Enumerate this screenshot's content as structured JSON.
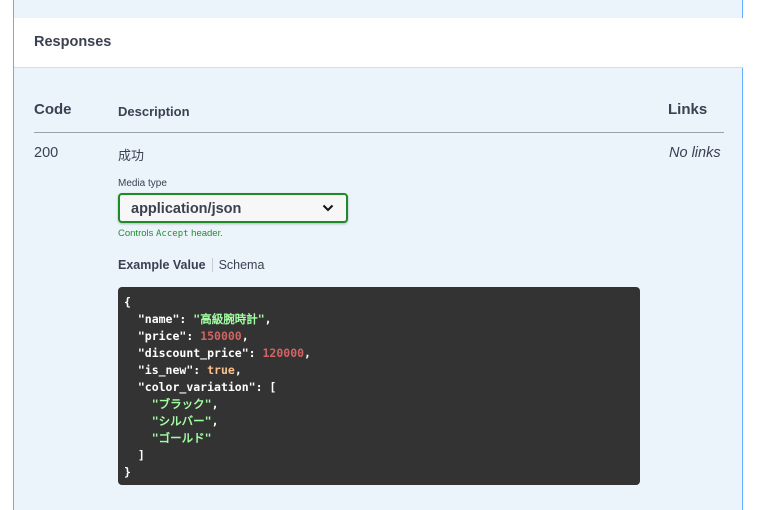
{
  "responses": {
    "title": "Responses",
    "columns": {
      "code": "Code",
      "description": "Description",
      "links": "Links"
    },
    "rows": [
      {
        "code": "200",
        "description": "成功",
        "links": "No links",
        "media_type_label": "Media type",
        "media_type_value": "application/json",
        "controls_prefix": "Controls",
        "controls_code": "Accept",
        "controls_suffix": "header.",
        "tabs": {
          "example": "Example Value",
          "schema": "Schema"
        },
        "example": {
          "open_brace": "{",
          "name_key": "\"name\"",
          "name_value": "\"高級腕時計\"",
          "price_key": "\"price\"",
          "price_value": "150000",
          "discount_key": "\"discount_price\"",
          "discount_value": "120000",
          "is_new_key": "\"is_new\"",
          "is_new_value": "true",
          "color_key": "\"color_variation\"",
          "colors": [
            "\"ブラック\"",
            "\"シルバー\"",
            "\"ゴールド\""
          ],
          "close_bracket": "]",
          "close_brace": "}"
        }
      }
    ]
  },
  "colors": {
    "opblock_bg": "#ebf3fb",
    "opblock_border": "#61affe",
    "select_border": "#1f8a28",
    "code_bg": "#333333",
    "json_string": "#a2fca2",
    "json_number": "#d36363",
    "json_boolean": "#fcc28c"
  }
}
